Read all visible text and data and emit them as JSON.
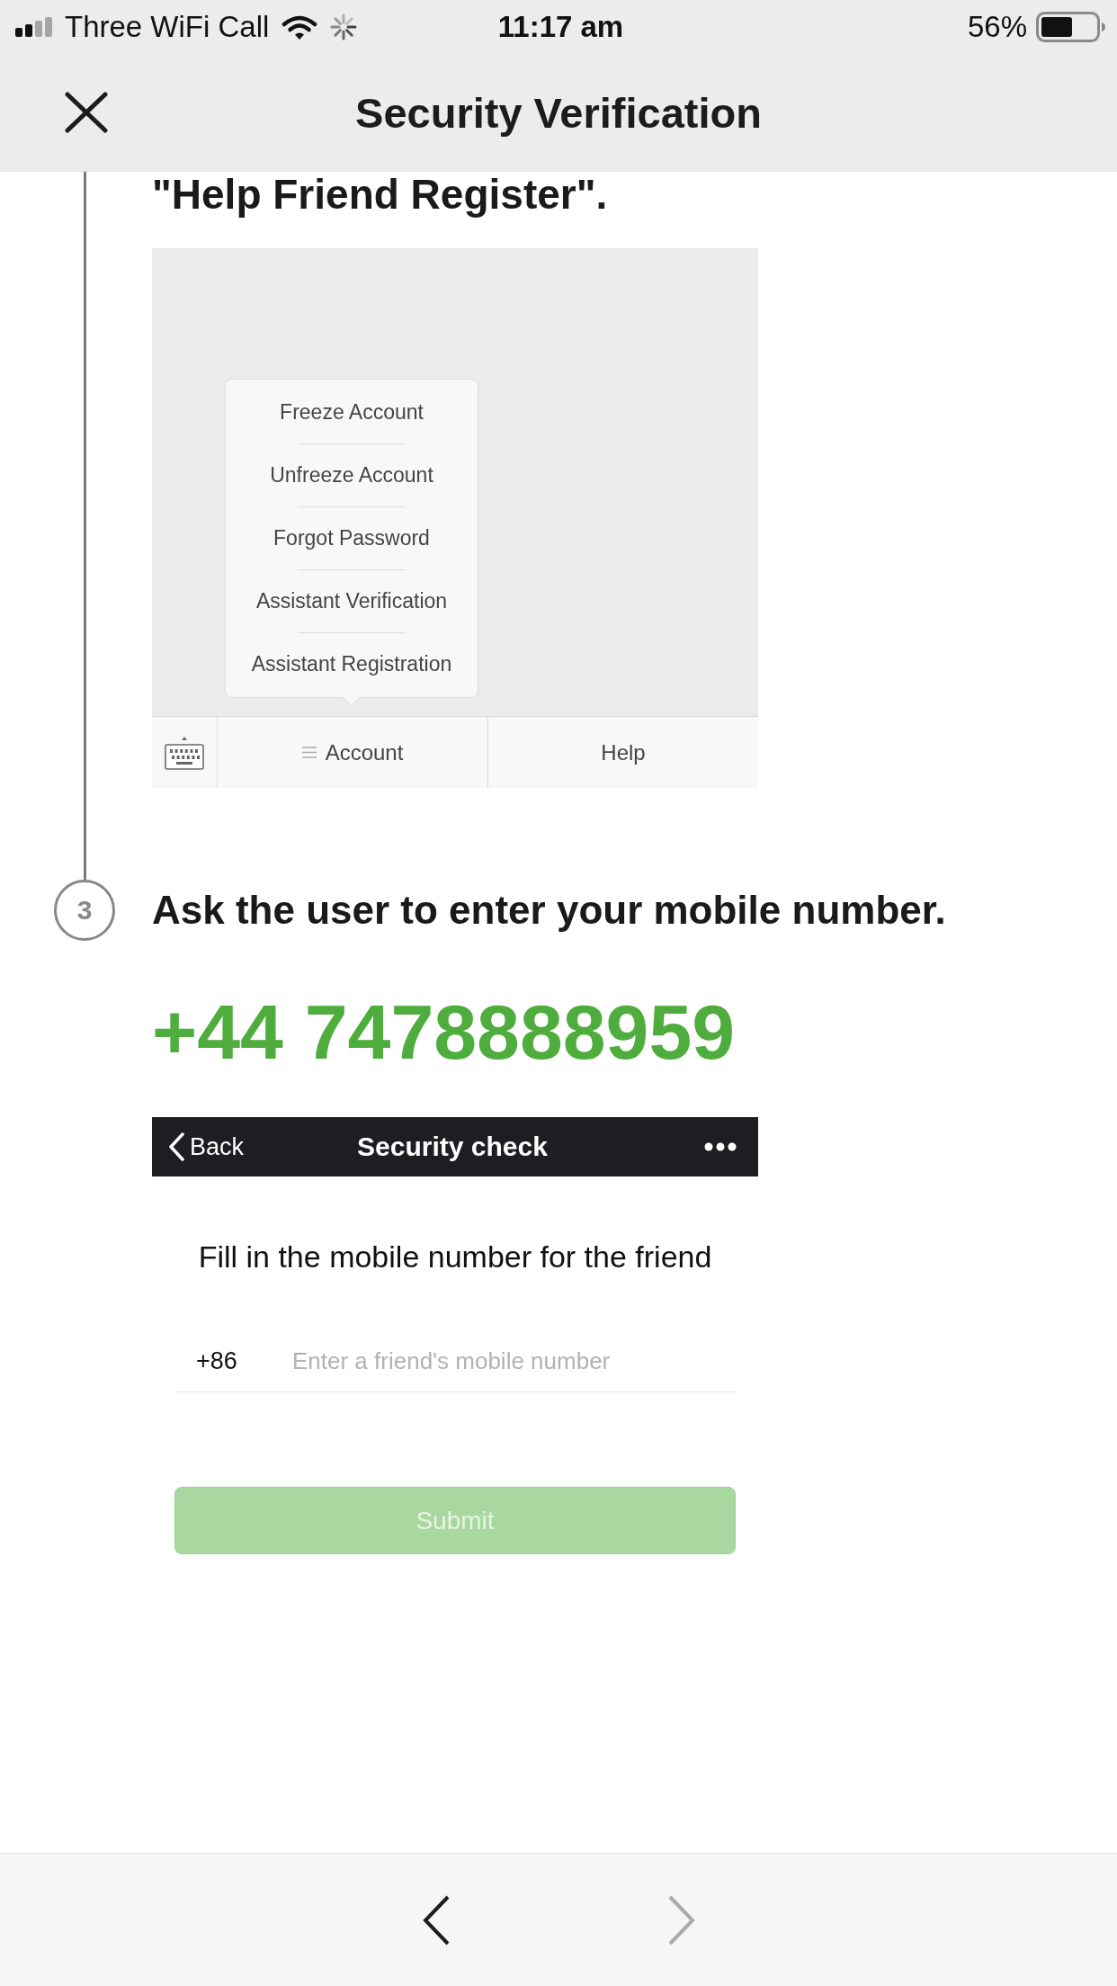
{
  "status_bar": {
    "carrier": "Three WiFi Call",
    "time": "11:17 am",
    "battery": "56%"
  },
  "header": {
    "title": "Security Verification"
  },
  "previous_step": {
    "text": "\"Help Friend Register\".",
    "screenshot": {
      "menu_items": [
        "Freeze Account",
        "Unfreeze Account",
        "Forgot Password",
        "Assistant Verification",
        "Assistant Registration"
      ],
      "tab_bar": [
        {
          "kind": "keyboard"
        },
        {
          "kind": "menu",
          "label": "Account"
        },
        {
          "kind": "text",
          "label": "Help"
        }
      ]
    }
  },
  "step": {
    "number": "3",
    "text": "Ask the user to enter your mobile number.",
    "phone": "+44 7478888959",
    "screenshot": {
      "nav_bar": {
        "back": "Back",
        "title": "Security check"
      },
      "prompt": "Fill in the mobile number for the friend",
      "country_code": "+86",
      "placeholder": "Enter a friend's mobile number",
      "submit": {
        "label": "Submit",
        "disabled": true
      }
    }
  },
  "bottom_nav": [
    {
      "kind": "back",
      "disabled": false
    },
    {
      "kind": "forward",
      "disabled": true
    }
  ]
}
